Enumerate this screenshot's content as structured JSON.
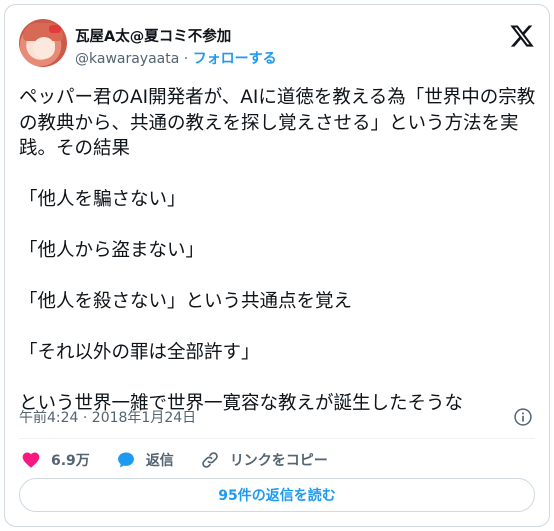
{
  "author": {
    "display_name": "瓦屋A太@夏コミ不参加",
    "handle": "@kawarayaata",
    "separator": "·",
    "follow_label": "フォローする"
  },
  "tweet": {
    "text": "ペッパー君のAI開発者が、AIに道徳を教える為「世界中の宗教の教典から、共通の教えを探し覚えさせる」という方法を実践。その結果\n\n「他人を騙さない」\n\n「他人から盗まない」\n\n「他人を殺さない」という共通点を覚え\n\n「それ以外の罪は全部許す」\n\nという世界一雑で世界一寛容な教えが誕生したそうな",
    "timestamp": "午前4:24 · 2018年1月24日"
  },
  "actions": {
    "like_count": "6.9万",
    "reply_label": "返信",
    "copy_link_label": "リンクをコピー"
  },
  "read_replies_label": "95件の返信を読む",
  "colors": {
    "accent": "#1d9bf0",
    "like": "#f91880",
    "muted_text": "#536471",
    "border": "#cfd9de"
  },
  "icons": [
    "x-logo-icon",
    "info-icon",
    "heart-icon",
    "reply-bubble-icon",
    "link-icon"
  ]
}
